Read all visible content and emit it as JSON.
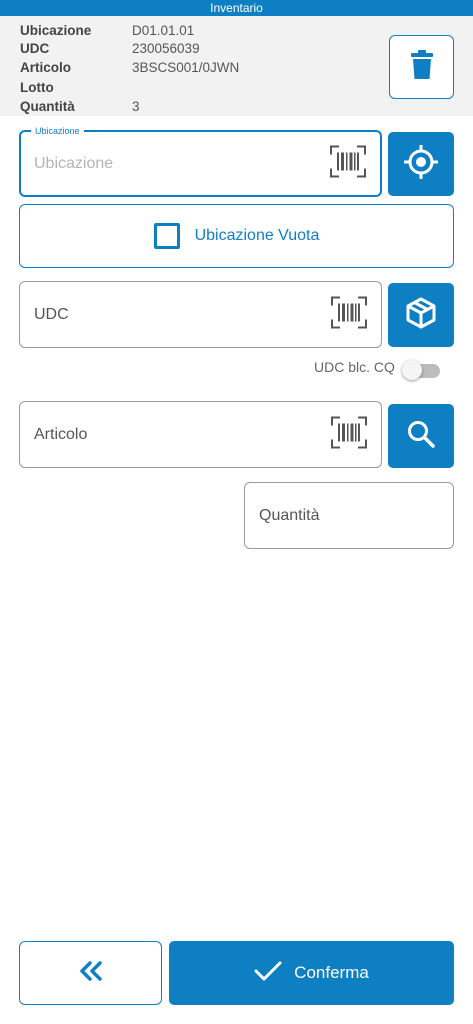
{
  "header": {
    "title": "Inventario"
  },
  "info": {
    "rows": [
      {
        "key": "Ubicazione",
        "value": "D01.01.01"
      },
      {
        "key": "UDC",
        "value": "230056039"
      },
      {
        "key": "Articolo",
        "value": "3BSCS001/0JWN"
      },
      {
        "key": "Lotto",
        "value": ""
      },
      {
        "key": "Quantità",
        "value": "3"
      }
    ]
  },
  "form": {
    "ubicazione": {
      "legend": "Ubicazione",
      "placeholder": "Ubicazione"
    },
    "vuota": {
      "label": "Ubicazione Vuota",
      "checked": false
    },
    "udc": {
      "placeholder": "UDC"
    },
    "udc_toggle": {
      "label": "UDC blc. CQ",
      "on": false
    },
    "articolo": {
      "placeholder": "Articolo"
    },
    "quantita": {
      "placeholder": "Quantità"
    }
  },
  "footer": {
    "confirm_label": "Conferma"
  },
  "icons": {
    "trash": "trash-icon",
    "locate": "locate-icon",
    "box": "box-icon",
    "search": "search-icon",
    "barcode": "barcode-scan-icon",
    "back": "double-chevron-left-icon",
    "check": "check-icon"
  },
  "colors": {
    "accent": "#0f7fc4",
    "header_bg": "#0f7fc4",
    "info_bg": "#f2f2f2"
  }
}
